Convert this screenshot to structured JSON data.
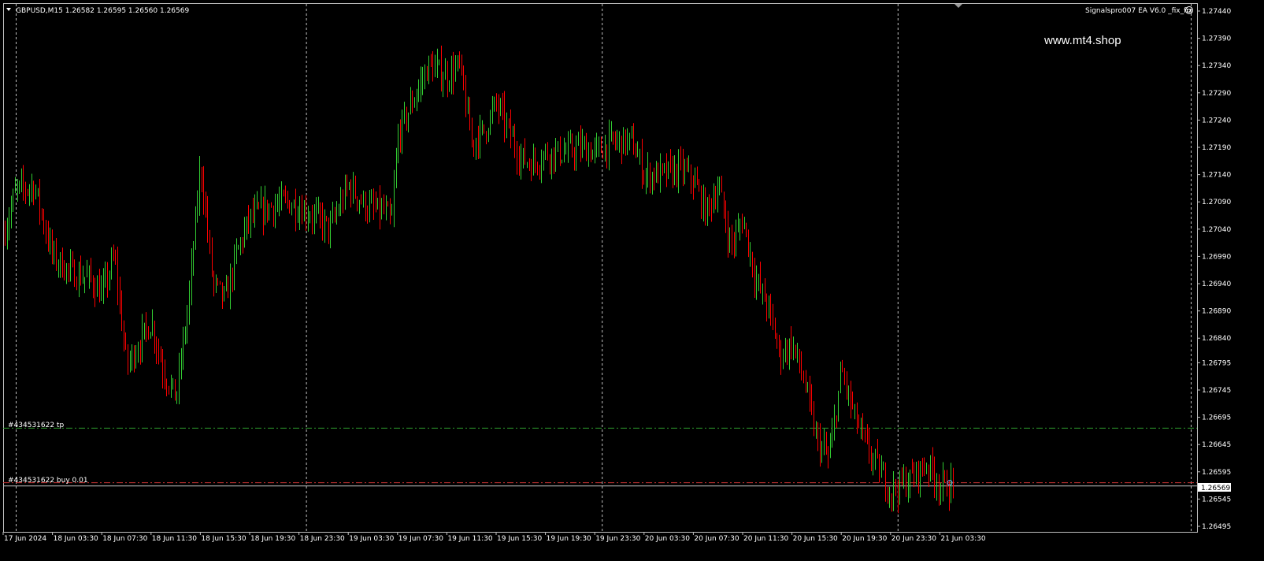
{
  "header": {
    "symbol_info": "GBPUSD,M15  1.26582 1.26595 1.26560 1.26569",
    "ea_label": "Signalspro007 EA  V6.0 _fix_fix",
    "watermark": "www.mt4.shop"
  },
  "order_lines": {
    "tp_label": "#434531622 tp",
    "tp_price": 1.26675,
    "buy_label": "#434531622 buy 0.01",
    "buy_price": 1.26575
  },
  "current_price_label": "1.26569",
  "colors": {
    "background": "#000000",
    "bull": "#32cd32",
    "bear": "#ff0000",
    "grid": "#c0c0c0",
    "tp_line": "#2e9e2e",
    "buy_line": "#c83232",
    "axis_text": "#ffffff"
  },
  "chart_data": {
    "type": "candlestick",
    "symbol": "GBPUSD",
    "timeframe": "M15",
    "ylim": [
      1.26485,
      1.2745
    ],
    "y_ticks": [
      "1.27440",
      "1.27390",
      "1.27340",
      "1.27290",
      "1.27240",
      "1.27190",
      "1.27140",
      "1.27090",
      "1.27040",
      "1.26990",
      "1.26940",
      "1.26890",
      "1.26840",
      "1.26795",
      "1.26745",
      "1.26695",
      "1.26645",
      "1.26595",
      "1.26545",
      "1.26495"
    ],
    "x_ticks": [
      "17 Jun 2024",
      "18 Jun 03:30",
      "18 Jun 07:30",
      "18 Jun 11:30",
      "18 Jun 15:30",
      "18 Jun 19:30",
      "18 Jun 23:30",
      "19 Jun 03:30",
      "19 Jun 07:30",
      "19 Jun 11:30",
      "19 Jun 15:30",
      "19 Jun 19:30",
      "19 Jun 23:30",
      "20 Jun 03:30",
      "20 Jun 07:30",
      "20 Jun 11:30",
      "20 Jun 15:30",
      "20 Jun 19:30",
      "20 Jun 23:30",
      "21 Jun 03:30"
    ],
    "vertical_grid_ticks": [
      "17 Jun 2024",
      "18 Jun 23:30",
      "19 Jun 23:30",
      "20 Jun 23:30"
    ],
    "price_path": [
      [
        "17 Jun 2024",
        1.2703
      ],
      [
        "18 Jun 00:30",
        1.2711
      ],
      [
        "18 Jun 02:00",
        1.2712
      ],
      [
        "18 Jun 03:30",
        1.2699
      ],
      [
        "18 Jun 05:00",
        1.2696
      ],
      [
        "18 Jun 06:30",
        1.2695
      ],
      [
        "18 Jun 07:30",
        1.2692
      ],
      [
        "18 Jun 08:30",
        1.2699
      ],
      [
        "18 Jun 09:30",
        1.2679
      ],
      [
        "18 Jun 10:30",
        1.2683
      ],
      [
        "18 Jun 11:30",
        1.2687
      ],
      [
        "18 Jun 12:30",
        1.2678
      ],
      [
        "18 Jun 13:30",
        1.2673
      ],
      [
        "18 Jun 14:30",
        1.269
      ],
      [
        "18 Jun 15:30",
        1.2716
      ],
      [
        "18 Jun 16:30",
        1.2694
      ],
      [
        "18 Jun 17:30",
        1.2691
      ],
      [
        "18 Jun 18:30",
        1.27
      ],
      [
        "18 Jun 19:30",
        1.2706
      ],
      [
        "18 Jun 21:00",
        1.2708
      ],
      [
        "18 Jun 22:30",
        1.2709
      ],
      [
        "18 Jun 23:30",
        1.2708
      ],
      [
        "19 Jun 01:00",
        1.2706
      ],
      [
        "19 Jun 02:00",
        1.2704
      ],
      [
        "19 Jun 03:30",
        1.2712
      ],
      [
        "19 Jun 05:00",
        1.2708
      ],
      [
        "19 Jun 06:30",
        1.2707
      ],
      [
        "19 Jun 07:00",
        1.2705
      ],
      [
        "19 Jun 07:30",
        1.2721
      ],
      [
        "19 Jun 09:00",
        1.2729
      ],
      [
        "19 Jun 10:00",
        1.2734
      ],
      [
        "19 Jun 11:30",
        1.2732
      ],
      [
        "19 Jun 12:30",
        1.2734
      ],
      [
        "19 Jun 13:30",
        1.272
      ],
      [
        "19 Jun 14:30",
        1.2722
      ],
      [
        "19 Jun 15:30",
        1.2727
      ],
      [
        "19 Jun 16:30",
        1.2722
      ],
      [
        "19 Jun 17:30",
        1.2717
      ],
      [
        "19 Jun 18:30",
        1.2716
      ],
      [
        "19 Jun 19:30",
        1.2718
      ],
      [
        "19 Jun 21:00",
        1.2718
      ],
      [
        "19 Jun 22:30",
        1.2719
      ],
      [
        "19 Jun 23:30",
        1.2718
      ],
      [
        "20 Jun 01:00",
        1.272
      ],
      [
        "20 Jun 02:30",
        1.272
      ],
      [
        "20 Jun 03:30",
        1.2714
      ],
      [
        "20 Jun 05:00",
        1.2714
      ],
      [
        "20 Jun 06:30",
        1.2715
      ],
      [
        "20 Jun 07:30",
        1.2713
      ],
      [
        "20 Jun 08:30",
        1.2707
      ],
      [
        "20 Jun 09:30",
        1.2712
      ],
      [
        "20 Jun 10:30",
        1.2701
      ],
      [
        "20 Jun 11:00",
        1.2703
      ],
      [
        "20 Jun 11:30",
        1.2706
      ],
      [
        "20 Jun 12:30",
        1.2695
      ],
      [
        "20 Jun 13:30",
        1.269
      ],
      [
        "20 Jun 14:30",
        1.2681
      ],
      [
        "20 Jun 15:30",
        1.2683
      ],
      [
        "20 Jun 16:30",
        1.2676
      ],
      [
        "20 Jun 17:30",
        1.2665
      ],
      [
        "20 Jun 18:30",
        1.2662
      ],
      [
        "20 Jun 19:30",
        1.2678
      ],
      [
        "20 Jun 20:30",
        1.267
      ],
      [
        "20 Jun 21:30",
        1.2664
      ],
      [
        "20 Jun 22:30",
        1.266
      ],
      [
        "20 Jun 23:30",
        1.2656
      ],
      [
        "21 Jun 01:00",
        1.2658
      ],
      [
        "21 Jun 02:30",
        1.2661
      ],
      [
        "21 Jun 03:30",
        1.26569
      ]
    ]
  }
}
